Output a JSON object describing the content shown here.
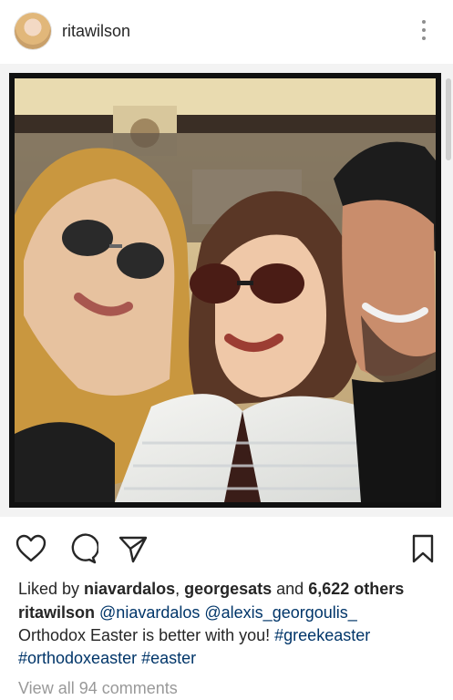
{
  "post": {
    "username": "ritawilson",
    "likes": {
      "prefix": "Liked by ",
      "user1": "niavardalos",
      "sep": ", ",
      "user2": "georgesats",
      "and": " and ",
      "count": "6,622 others"
    },
    "caption": {
      "author": "ritawilson",
      "mention1": "@niavardalos",
      "mention2": "@alexis_georgoulis_",
      "text": "Orthodox Easter is better with you!",
      "tag1": "#greekeaster",
      "tag2": "#orthodoxeaster",
      "tag3": "#easter"
    },
    "view_comments": "View all 94 comments"
  },
  "icons": {
    "more": "more-options-icon",
    "like": "heart-icon",
    "comment": "comment-icon",
    "share": "share-icon",
    "save": "bookmark-icon"
  }
}
